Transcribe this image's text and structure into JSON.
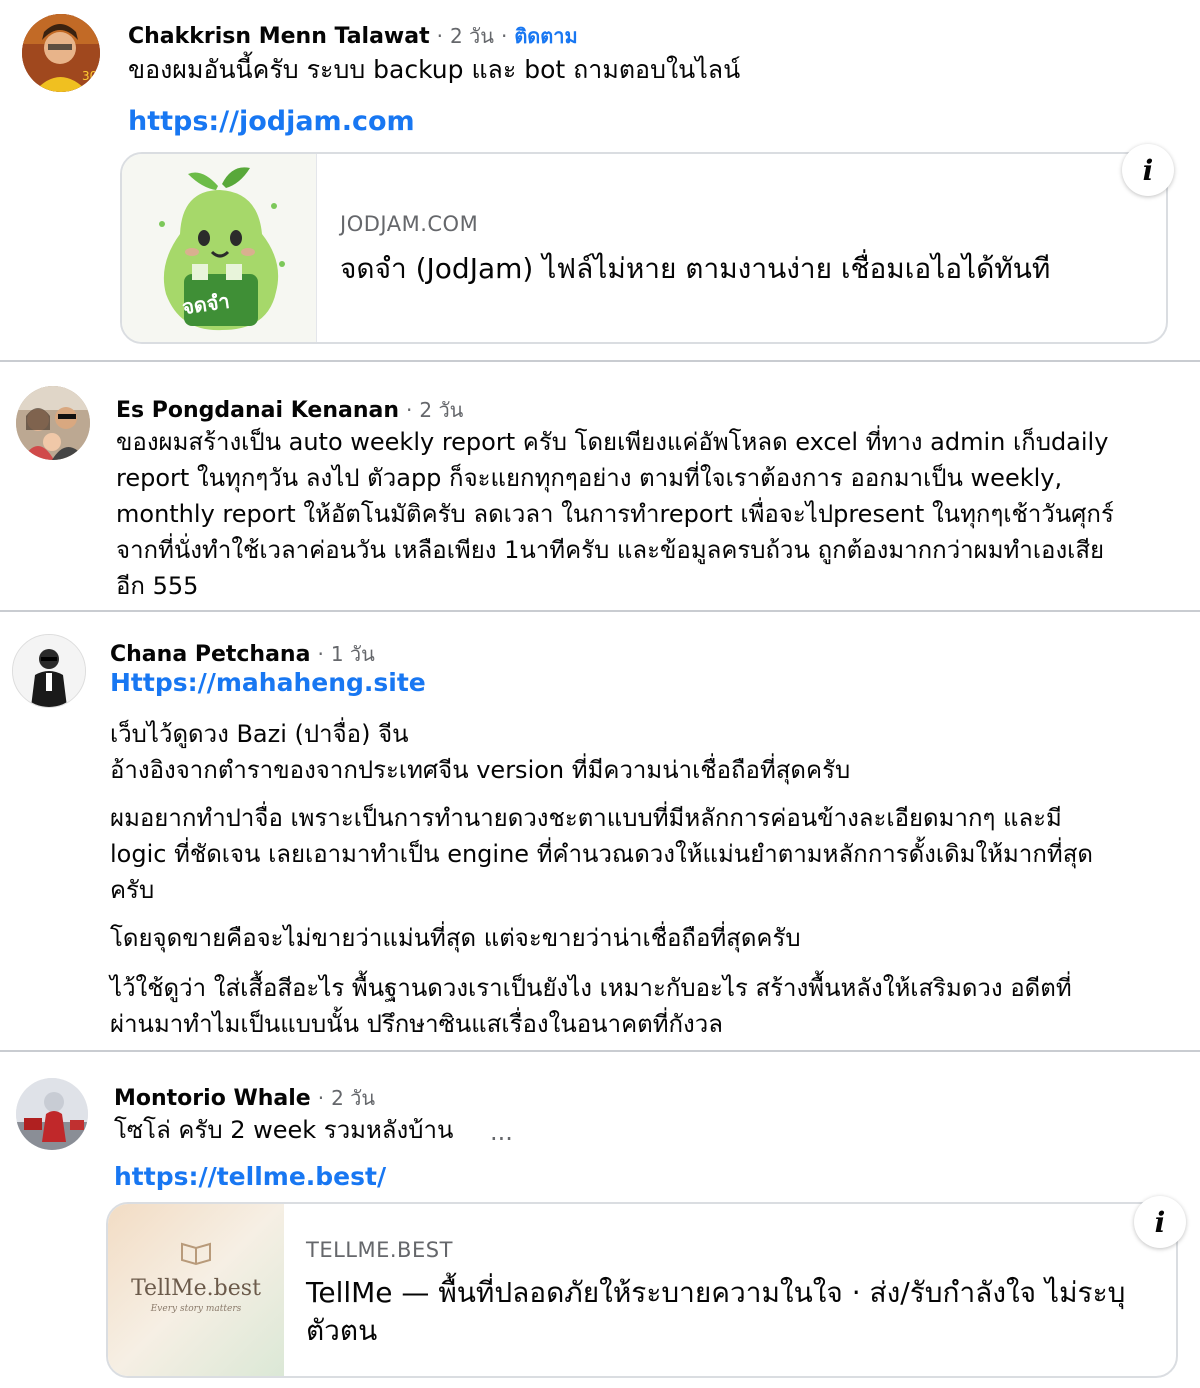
{
  "comments": [
    {
      "author": "Chakkrisn Menn Talawat",
      "time": "2 วัน",
      "follow": "ติดตาม",
      "text": "ของผมอันนี้ครับ ระบบ backup และ bot ถามตอบในไลน์",
      "link": "https://jodjam.com",
      "card": {
        "domain": "JODJAM.COM",
        "title": "จดจำ (JodJam) ไฟล์ไม่หาย ตามงานง่าย เชื่อมเอไอได้ทันที",
        "logo_text": "จดจำ",
        "info_icon": "i"
      }
    },
    {
      "author": "Es Pongdanai Kenanan",
      "time": "2 วัน",
      "lines": [
        "ของผมสร้างเป็น auto weekly report ครับ โดยเพียงแค่อัพโหลด excel ที่ทาง admin เก็บdaily",
        "report ในทุกๆวัน ลงไป ตัวapp ก็จะแยกทุกๆอย่าง ตามที่ใจเราต้องการ ออกมาเป็น weekly,",
        "monthly report ให้อัตโนมัติครับ ลดเวลา ในการทำreport เพื่อจะไปpresent ในทุกๆเช้าวันศุกร์",
        "จากที่นั่งทำใช้เวลาค่อนวัน เหลือเพียง 1นาทีครับ และข้อมูลครบถ้วน ถูกต้องมากกว่าผมทำเองเสีย",
        "อีก 555"
      ]
    },
    {
      "author": "Chana Petchana",
      "time": "1 วัน",
      "link": "Https://mahaheng.site",
      "paragraphs": [
        [
          "เว็บไว้ดูดวง Bazi (ปาจื่อ) จีน",
          "อ้างอิงจากตำราของจากประเทศจีน version ที่มีความน่าเชื่อถือที่สุดครับ"
        ],
        [
          "ผมอยากทำปาจื่อ เพราะเป็นการทำนายดวงชะตาแบบที่มีหลักการค่อนข้างละเอียดมากๆ และมี",
          "logic ที่ชัดเจน เลยเอามาทำเป็น engine ที่คำนวณดวงให้แม่นยำตามหลักการดั้งเดิมให้มากที่สุด",
          "ครับ"
        ],
        [
          "โดยจุดขายคือจะไม่ขายว่าแม่นที่สุด แต่จะขายว่าน่าเชื่อถือที่สุดครับ"
        ],
        [
          "ไว้ใช้ดูว่า ใส่เสื้อสีอะไร พื้นฐานดวงเราเป็นยังไง เหมาะกับอะไร สร้างพื้นหลังให้เสริมดวง อดีตที่",
          "ผ่านมาทำไมเป็นแบบนั้น ปรึกษาซินแสเรื่องในอนาคตที่กังวล"
        ]
      ]
    },
    {
      "author": "Montorio Whale",
      "time": "2 วัน",
      "text": "โซโล่ ครับ 2 week รวมหลังบ้าน",
      "more": "...",
      "link": "https://tellme.best/",
      "card": {
        "domain": "TELLME.BEST",
        "title_lines": [
          "TellMe — พื้นที่ปลอดภัยให้ระบายความในใจ · ส่ง/รับกำลังใจ ไม่ระบุ",
          "ตัวตน"
        ],
        "logo_text": "TellMe.best",
        "logo_sub": "Every story matters",
        "info_icon": "i"
      }
    }
  ],
  "separator": "·"
}
